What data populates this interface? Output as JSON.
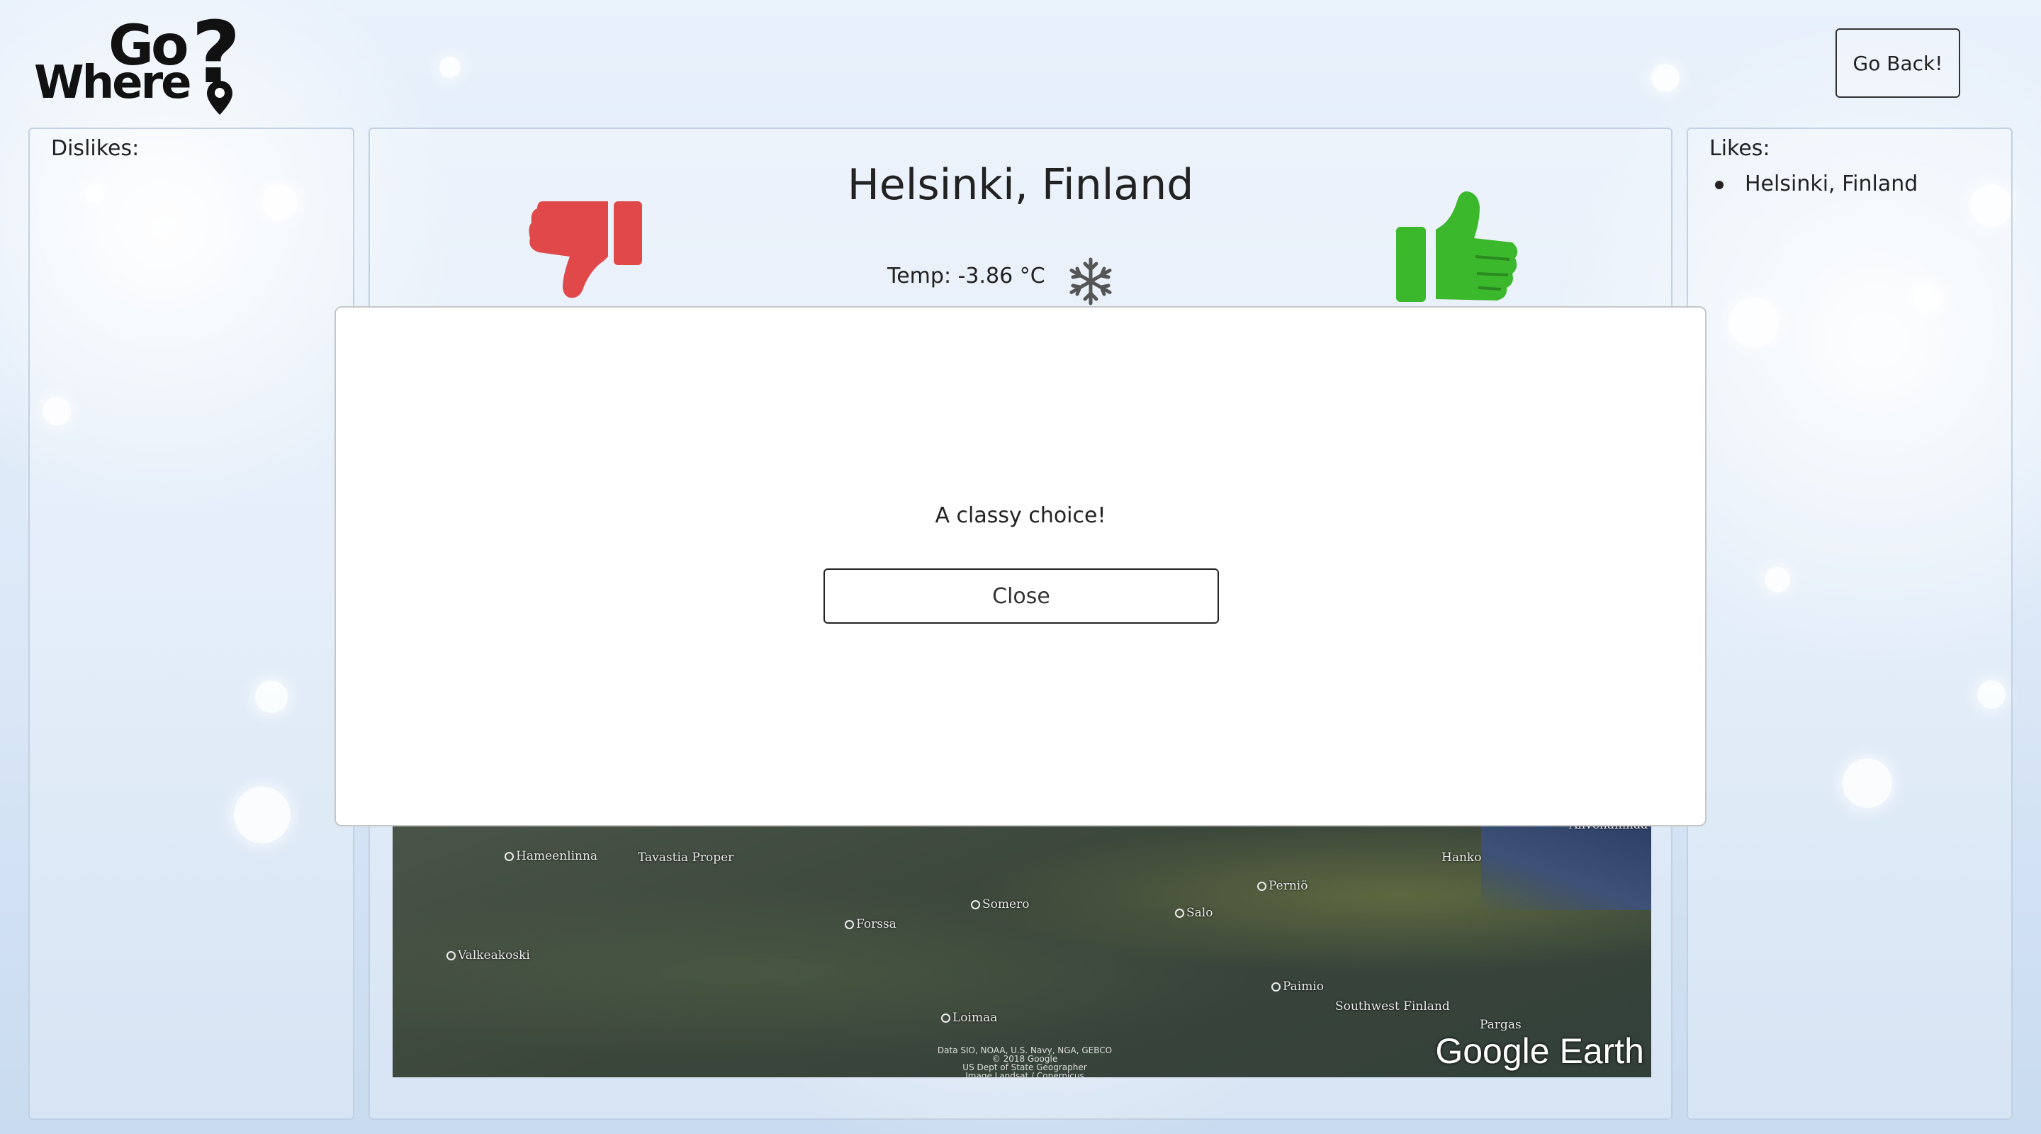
{
  "logo": {
    "line1": "Go",
    "line2": "Where",
    "mark": "?"
  },
  "header": {
    "back_label": "Go Back!"
  },
  "dislikes": {
    "label": "Dislikes:",
    "items": []
  },
  "likes": {
    "label": "Likes:",
    "items": [
      "Helsinki, Finland"
    ]
  },
  "destination": {
    "title": "Helsinki, Finland",
    "temp": "Temp: -3.86 °C",
    "weather_icon": "snowflake-icon"
  },
  "map": {
    "labels": [
      "Hameenlinna",
      "Tavastia Proper",
      "Valkeakoski",
      "Forssa",
      "Somero",
      "Salo",
      "Perniö",
      "Hanko",
      "Paimio",
      "Southwest Finland",
      "Pargas",
      "Loimaa",
      "Ahvenanmaa"
    ],
    "credit": [
      "Data SIO, NOAA, U.S. Navy, NGA, GEBCO",
      "© 2018 Google",
      "US Dept of State Geographer",
      "Image Landsat / Copernicus"
    ],
    "brand": "Google Earth"
  },
  "modal": {
    "message": "A classy choice!",
    "close_label": "Close"
  },
  "colors": {
    "dislike": "#e0484a",
    "like": "#3cb82c",
    "text": "#222222"
  }
}
